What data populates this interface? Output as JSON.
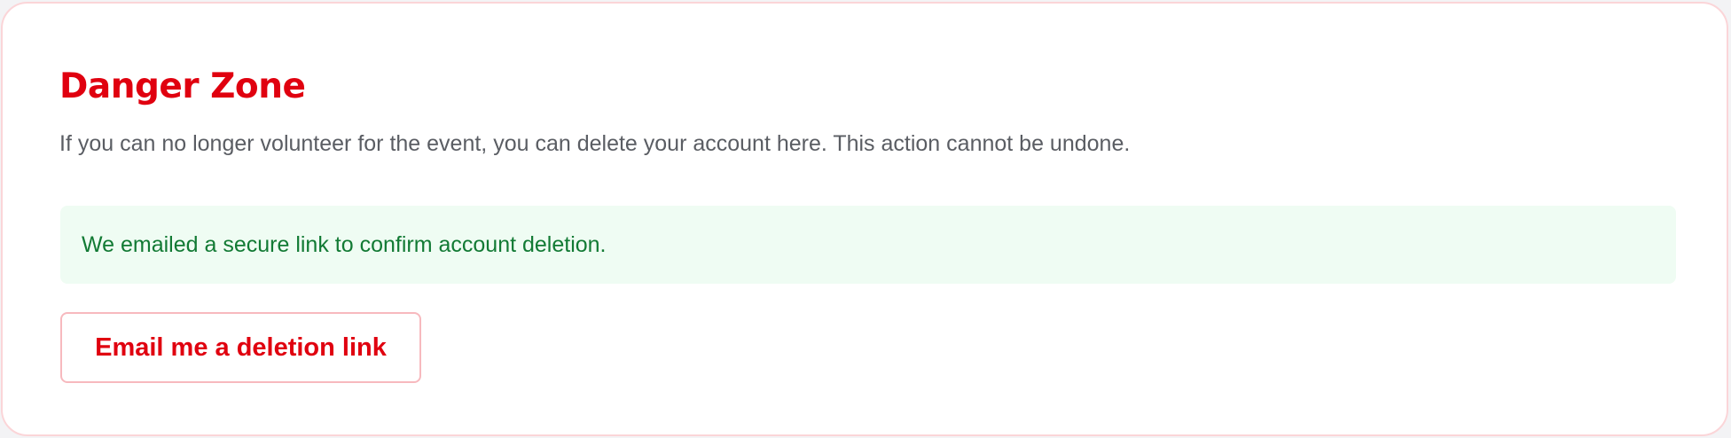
{
  "danger_zone": {
    "title": "Danger Zone",
    "description": "If you can no longer volunteer for the event, you can delete your account here. This action cannot be undone.",
    "notice": "We emailed a secure link to confirm account deletion.",
    "button_label": "Email me a deletion link"
  },
  "colors": {
    "accent": "#e0000f",
    "success_text": "#127a34",
    "success_bg": "#effcf3",
    "border": "#fbd5d8"
  }
}
